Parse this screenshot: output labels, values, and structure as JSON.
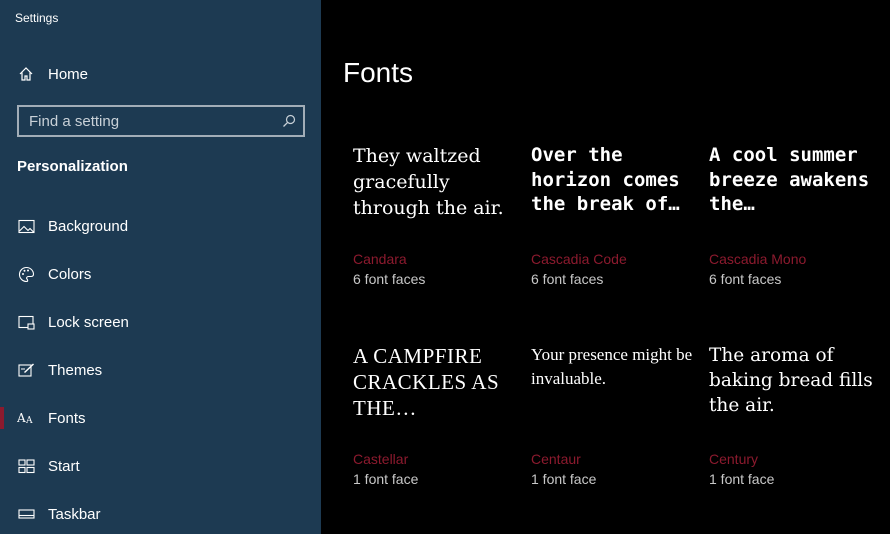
{
  "app": {
    "title": "Settings"
  },
  "sidebar": {
    "home_label": "Home",
    "search": {
      "placeholder": "Find a setting",
      "value": ""
    },
    "section_heading": "Personalization",
    "items": [
      {
        "label": "Background",
        "icon": "image-icon",
        "selected": false
      },
      {
        "label": "Colors",
        "icon": "palette-icon",
        "selected": false
      },
      {
        "label": "Lock screen",
        "icon": "lock-screen-icon",
        "selected": false
      },
      {
        "label": "Themes",
        "icon": "themes-icon",
        "selected": false
      },
      {
        "label": "Fonts",
        "icon": "font-icon",
        "selected": true
      },
      {
        "label": "Start",
        "icon": "start-icon",
        "selected": false
      },
      {
        "label": "Taskbar",
        "icon": "taskbar-icon",
        "selected": false
      }
    ],
    "selected_color": "#8c1a2e"
  },
  "main": {
    "title": "Fonts",
    "fonts": [
      {
        "sample": "They waltzed gracefully through the air.",
        "name": "Candara",
        "faces": "6 font faces"
      },
      {
        "sample": "Over the horizon comes the break of…",
        "name": "Cascadia Code",
        "faces": "6 font faces"
      },
      {
        "sample": "A cool summer breeze awakens the…",
        "name": "Cascadia Mono",
        "faces": "6 font faces"
      },
      {
        "sample": "A CAMPFIRE CRACKLES AS THE…",
        "name": "Castellar",
        "faces": "1 font face"
      },
      {
        "sample": "Your presence might be invaluable.",
        "name": "Centaur",
        "faces": "1 font face"
      },
      {
        "sample": "The aroma of baking bread fills the air.",
        "name": "Century",
        "faces": "1 font face"
      }
    ],
    "accent_color": "#8c1a2e"
  }
}
